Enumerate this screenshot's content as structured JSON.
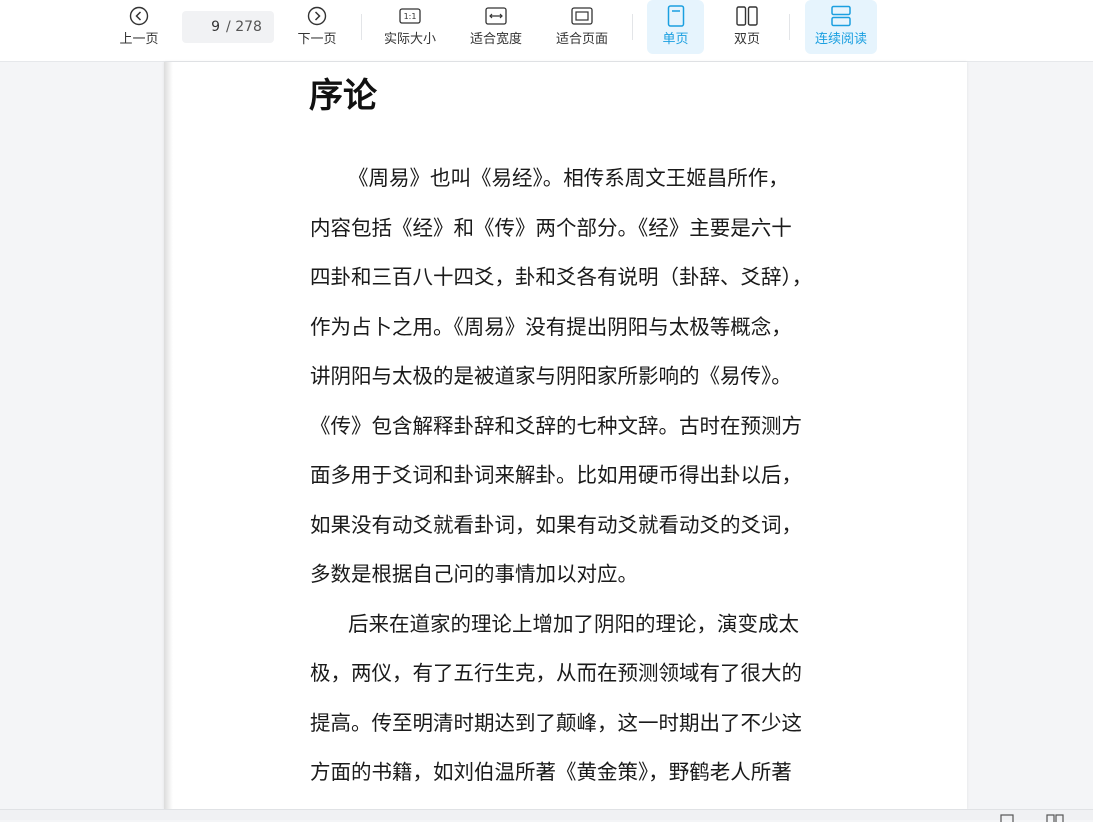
{
  "toolbar": {
    "prev_label": "上一页",
    "page_current": "9",
    "page_total": "/ 278",
    "next_label": "下一页",
    "actual_size_label": "实际大小",
    "fit_width_label": "适合宽度",
    "fit_page_label": "适合页面",
    "single_page_label": "单页",
    "double_page_label": "双页",
    "continuous_label": "连续阅读",
    "actual_size_icon_text": "1:1",
    "active_color": "#1a9fe0"
  },
  "document": {
    "heading": "序论",
    "lines": [
      "《周易》也叫《易经》。相传系周文王姬昌所作，",
      "内容包括《经》和《传》两个部分。《经》主要是六十",
      "四卦和三百八十四爻，卦和爻各有说明（卦辞、爻辞），",
      "作为占卜之用。《周易》没有提出阴阳与太极等概念，",
      "讲阴阳与太极的是被道家与阴阳家所影响的《易传》。",
      "《传》包含解释卦辞和爻辞的七种文辞。古时在预测方",
      "面多用于爻词和卦词来解卦。比如用硬币得出卦以后，",
      "如果没有动爻就看卦词，如果有动爻就看动爻的爻词，",
      "多数是根据自己问的事情加以对应。",
      "后来在道家的理论上增加了阴阳的理论，演变成太",
      "极，两仪，有了五行生克，从而在预测领域有了很大的",
      "提高。传至明清时期达到了颠峰，这一时期出了不少这",
      "方面的书籍，如刘伯温所著《黄金策》，野鹤老人所著"
    ]
  },
  "icons": {
    "prev": "chevron-left-circle-icon",
    "next": "chevron-right-circle-icon",
    "actual_size": "actual-size-icon",
    "fit_width": "fit-width-icon",
    "fit_page": "fit-page-icon",
    "single_page": "single-page-icon",
    "double_page": "double-page-icon",
    "continuous": "continuous-reading-icon"
  }
}
